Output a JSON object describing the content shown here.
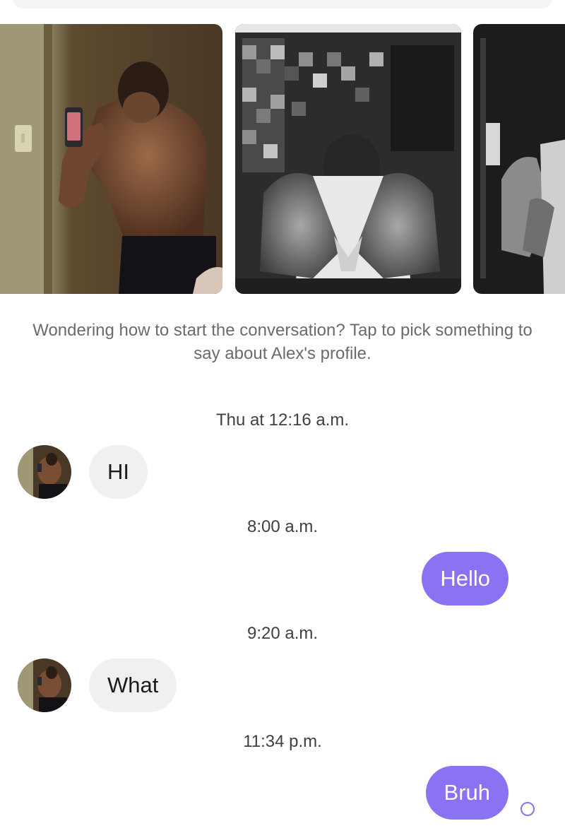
{
  "conversation": {
    "contact_name": "Alex",
    "prompt_text": "Wondering how to start the conversation? Tap to pick something to say about Alex's profile.",
    "messages": [
      {
        "timestamp": "Thu at 12:16 a.m.",
        "direction": "incoming",
        "text": "HI"
      },
      {
        "timestamp": "8:00 a.m.",
        "direction": "outgoing",
        "text": "Hello"
      },
      {
        "timestamp": "9:20 a.m.",
        "direction": "incoming",
        "text": "What"
      },
      {
        "timestamp": "11:34 p.m.",
        "direction": "outgoing",
        "text": "Bruh"
      }
    ]
  },
  "colors": {
    "accent": "#8a72f3",
    "incoming_bubble": "#f0f0f3",
    "prompt_text": "#6b6b6b",
    "timestamp_text": "#404040"
  }
}
